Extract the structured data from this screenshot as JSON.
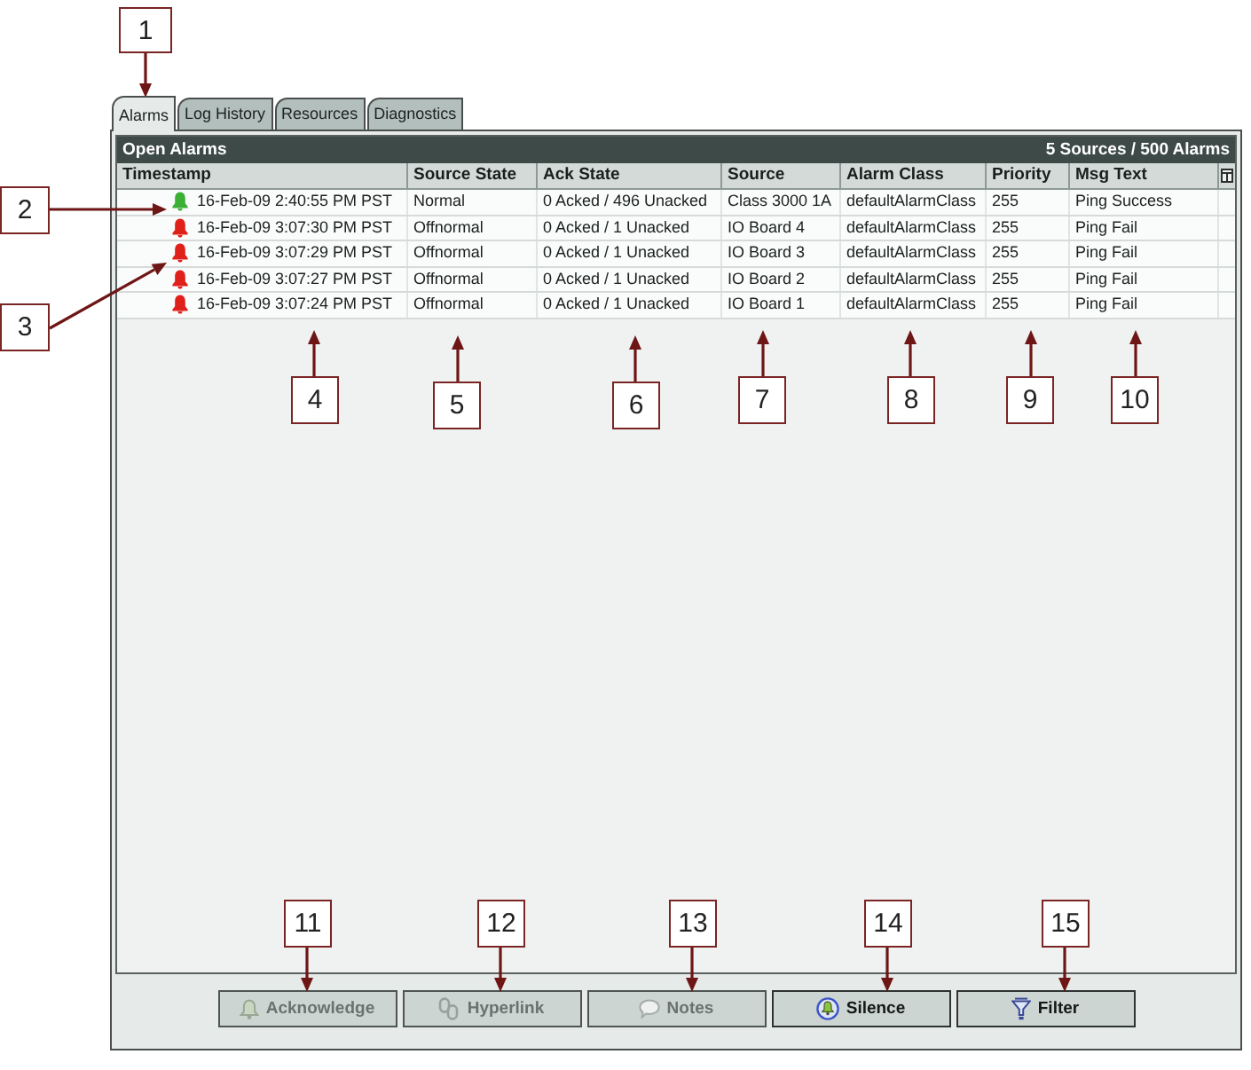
{
  "tabs": [
    {
      "label": "Alarms",
      "selected": true
    },
    {
      "label": "Log History",
      "selected": false
    },
    {
      "label": "Resources",
      "selected": false
    },
    {
      "label": "Diagnostics",
      "selected": false
    }
  ],
  "panel": {
    "title": "Open Alarms",
    "summary": "5 Sources / 500 Alarms"
  },
  "table": {
    "columns": [
      "Timestamp",
      "Source State",
      "Ack State",
      "Source",
      "Alarm Class",
      "Priority",
      "Msg Text"
    ],
    "rows": [
      {
        "color": "#3cb034",
        "cells": [
          "16-Feb-09 2:40:55 PM PST",
          "Normal",
          "0 Acked / 496 Unacked",
          "Class 3000 1A",
          "defaultAlarmClass",
          "255",
          "Ping Success"
        ]
      },
      {
        "color": "#e0201b",
        "cells": [
          "16-Feb-09 3:07:30 PM PST",
          "Offnormal",
          "0 Acked / 1 Unacked",
          "IO Board 4",
          "defaultAlarmClass",
          "255",
          "Ping Fail"
        ]
      },
      {
        "color": "#e0201b",
        "cells": [
          "16-Feb-09 3:07:29 PM PST",
          "Offnormal",
          "0 Acked / 1 Unacked",
          "IO Board 3",
          "defaultAlarmClass",
          "255",
          "Ping Fail"
        ]
      },
      {
        "color": "#e0201b",
        "cells": [
          "16-Feb-09 3:07:27 PM PST",
          "Offnormal",
          "0 Acked / 1 Unacked",
          "IO Board 2",
          "defaultAlarmClass",
          "255",
          "Ping Fail"
        ]
      },
      {
        "color": "#e0201b",
        "cells": [
          "16-Feb-09 3:07:24 PM PST",
          "Offnormal",
          "0 Acked / 1 Unacked",
          "IO Board 1",
          "defaultAlarmClass",
          "255",
          "Ping Fail"
        ]
      }
    ]
  },
  "buttons": [
    {
      "kind": "acknowledge",
      "label": "Acknowledge",
      "disabled": true
    },
    {
      "kind": "hyperlink",
      "label": "Hyperlink",
      "disabled": true
    },
    {
      "kind": "notes",
      "label": "Notes",
      "disabled": true
    },
    {
      "kind": "silence",
      "label": "Silence",
      "disabled": false
    },
    {
      "kind": "filter",
      "label": "Filter",
      "disabled": false
    }
  ],
  "callouts": [
    {
      "label": "1"
    },
    {
      "label": "2"
    },
    {
      "label": "3"
    },
    {
      "label": "4"
    },
    {
      "label": "5"
    },
    {
      "label": "6"
    },
    {
      "label": "7"
    },
    {
      "label": "8"
    },
    {
      "label": "9"
    },
    {
      "label": "10"
    },
    {
      "label": "11"
    },
    {
      "label": "12"
    },
    {
      "label": "13"
    },
    {
      "label": "14"
    },
    {
      "label": "15"
    }
  ]
}
